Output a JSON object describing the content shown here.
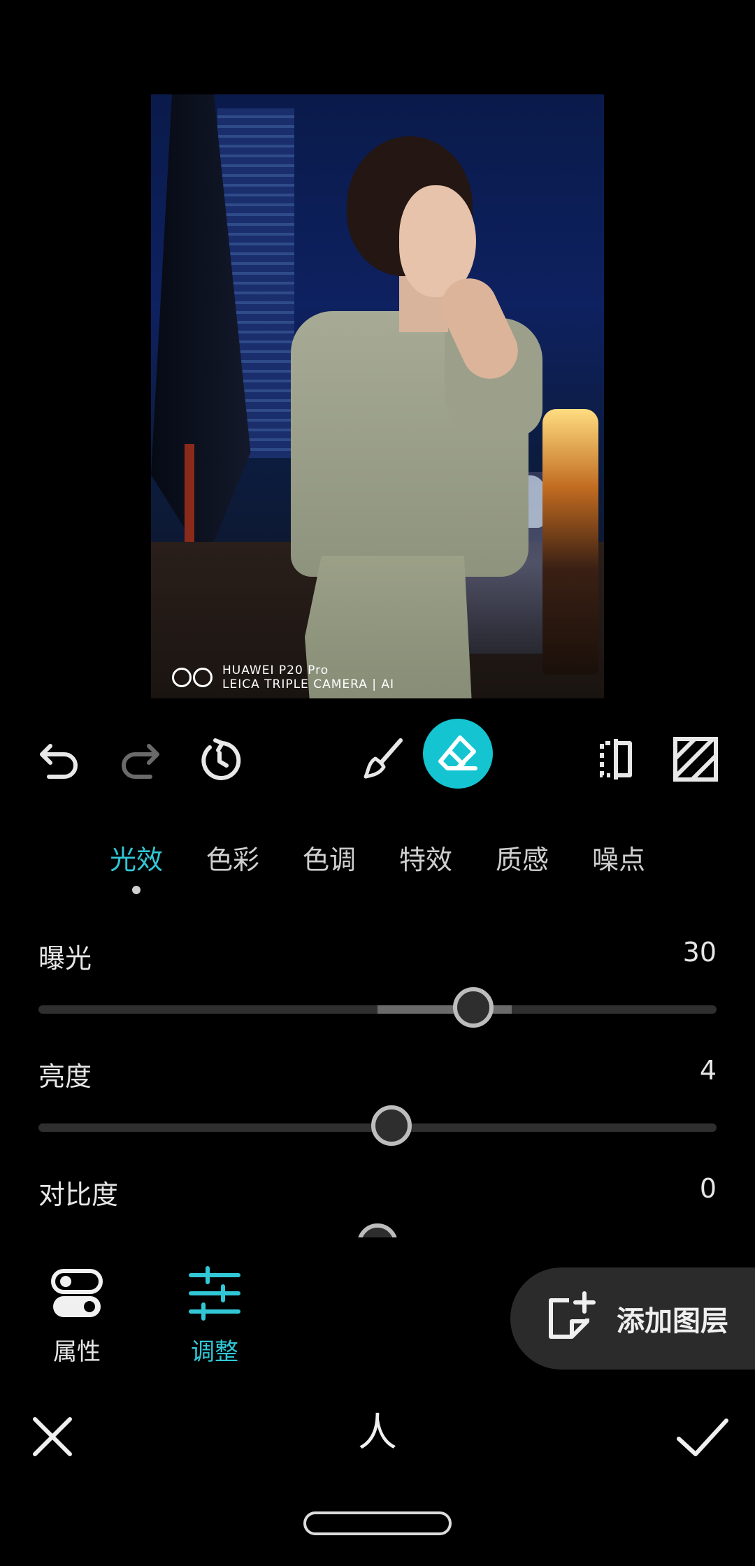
{
  "photo": {
    "watermark_line1": "HUAWEI P20 Pro",
    "watermark_line2": "LEICA TRIPLE CAMERA | AI"
  },
  "toolbar": {
    "icons": [
      "undo-icon",
      "redo-icon",
      "reset-icon",
      "brush-icon",
      "eraser-icon",
      "compare-icon",
      "mask-icon"
    ]
  },
  "tabs": [
    {
      "label": "光效",
      "active": true
    },
    {
      "label": "色彩",
      "active": false
    },
    {
      "label": "色调",
      "active": false
    },
    {
      "label": "特效",
      "active": false
    },
    {
      "label": "质感",
      "active": false
    },
    {
      "label": "噪点",
      "active": false
    }
  ],
  "sliders": [
    {
      "label": "曝光",
      "value": "30"
    },
    {
      "label": "亮度",
      "value": "4"
    },
    {
      "label": "对比度",
      "value": "0"
    }
  ],
  "modes": {
    "attributes_label": "属性",
    "adjust_label": "调整"
  },
  "add_layer_label": "添加图层",
  "action_bar": {
    "center_label": "人"
  },
  "colors": {
    "accent": "#31c7d6",
    "active_button": "#14c5d1",
    "background": "#000000"
  }
}
